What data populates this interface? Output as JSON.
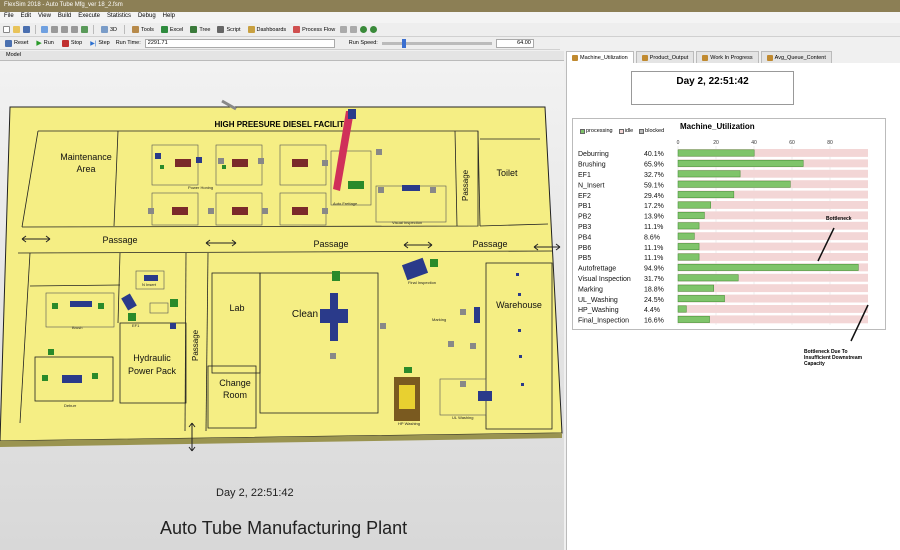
{
  "window": {
    "title": "FlexSim 2018 - Auto Tube Mfg_ver 18_2.fsm"
  },
  "menu": [
    "File",
    "Edit",
    "View",
    "Build",
    "Execute",
    "Statistics",
    "Debug",
    "Help"
  ],
  "toolbar": {
    "tools": "Tools",
    "excel": "Excel",
    "tree": "Tree",
    "script": "Script",
    "dashboards": "Dashboards",
    "process_flow": "Process Flow",
    "view3d": "3D"
  },
  "runbar": {
    "reset": "Reset",
    "run": "Run",
    "stop": "Stop",
    "step": "Step",
    "run_time_label": "Run Time:",
    "run_time": "2291.71",
    "run_speed_label": "Run Speed:",
    "run_speed": "64.00"
  },
  "model_tab": "Model",
  "model": {
    "facility_title": "HIGH PREESURE DIESEL FACILITY",
    "areas": {
      "maintenance": [
        "Maintenance",
        "Area"
      ],
      "toilet": "Toilet",
      "passage_h": "Passage",
      "passage_v": "Passage",
      "lab": "Lab",
      "clean": "Clean",
      "warehouse": "Warehouse",
      "hydraulic": [
        "Hydraulic",
        "Power Pack"
      ],
      "change_room": [
        "Change",
        "Room"
      ]
    },
    "small_labels": {
      "power_honing": "Power Honing",
      "auto_frettage": "Auto Frettage",
      "visual_inspection": "Visual Inspection",
      "final_inspection": "Final Inspection",
      "marking": "Marking",
      "n_insert": "N Insert",
      "brush": "Brush",
      "ef1": "EF1",
      "deburr": "Deburr",
      "hp_washing": "HP Washing",
      "ul_washing": "UL Washing"
    },
    "clock": "Day 2, 22:51:42",
    "plant_title": "Auto Tube Manufacturing Plant"
  },
  "right_tabs": [
    "Machine_Utilization",
    "Product_Output",
    "Work In Progress",
    "Avg_Queue_Content"
  ],
  "dashboard": {
    "clock": "Day 2, 22:51:42",
    "annotation_bottleneck": "Bottleneck",
    "annotation_downstream": "Bottleneck Due To Insufficient Downstream Capacity"
  },
  "colors": {
    "floor": "#f5ee84",
    "processing": "#7fc46a",
    "idle": "#f3d6d6",
    "blocked": "#bbbbbb",
    "accent": "#3a6fd0"
  },
  "chart_data": {
    "type": "bar",
    "title": "Machine_Utilization",
    "legend": [
      "processing",
      "idle",
      "blocked"
    ],
    "xlim": [
      0,
      100
    ],
    "ticks": [
      0,
      20,
      40,
      60,
      80
    ],
    "categories": [
      "Deburring",
      "Brushing",
      "EF1",
      "N_Insert",
      "EF2",
      "PB1",
      "PB2",
      "PB3",
      "PB4",
      "PB6",
      "PB5",
      "Autofrettage",
      "Visual Inspection",
      "Marking",
      "UL_Washing",
      "HP_Washing",
      "Final_Inspection"
    ],
    "value_labels": [
      "40.1%",
      "65.9%",
      "32.7%",
      "59.1%",
      "29.4%",
      "17.2%",
      "13.9%",
      "11.1%",
      "8.6%",
      "11.1%",
      "11.1%",
      "94.9%",
      "31.7%",
      "18.8%",
      "24.5%",
      "4.4%",
      "16.6%"
    ],
    "values": [
      40.1,
      65.9,
      32.7,
      59.1,
      29.4,
      17.2,
      13.9,
      11.1,
      8.6,
      11.1,
      11.1,
      94.9,
      31.7,
      18.8,
      24.5,
      4.4,
      16.6
    ]
  }
}
